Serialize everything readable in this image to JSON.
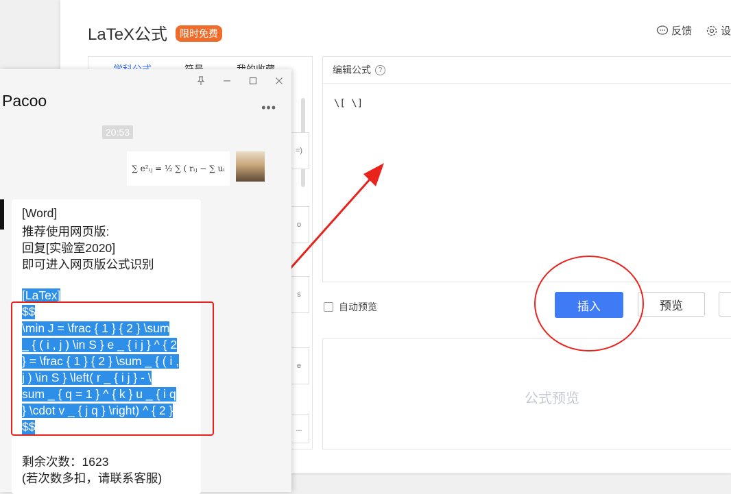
{
  "latex_dialog": {
    "title": "LaTeX公式",
    "badge": "限时免费",
    "feedback_label": "反馈",
    "settings_label": "设",
    "tabs": [
      "学科公式",
      "符号",
      "我的收藏"
    ],
    "thumb_labels": [
      "=)",
      "o",
      "s",
      "e",
      "..."
    ],
    "editor_label": "编辑公式",
    "editor_content": "\\[ \\]",
    "auto_preview_label": "自动预览",
    "insert_label": "插入",
    "preview_label": "预览",
    "preview_placeholder": "公式预览",
    "colors": {
      "primary": "#3e7bf4",
      "badge": "#f06c2b",
      "annotation": "#e8231c"
    }
  },
  "chat": {
    "title": "Pacoo",
    "time": "20:53",
    "sent_image_formula": "∑ e²ᵢⱼ = ½ ∑ ( rᵢⱼ − ∑ uᵢ",
    "message_lines": [
      "[Word]",
      "推荐使用网页版:",
      "回复[实验室2020]",
      "即可进入网页版公式识别",
      "[LaTex]",
      "$$",
      "\\min J = \\frac { 1 } { 2 } \\sum",
      " _ { ( i , j ) \\in S } e _ { i j } ^ { 2",
      " } = \\frac { 1 } { 2 } \\sum _ { ( i ,",
      " j ) \\in S } \\left( r _ { i j } - \\",
      "sum _ { q = 1 } ^ { k } u _ { i q",
      " } \\cdot v _ { j q } \\right) ^ { 2 }",
      "$$",
      "剩余次数：1623",
      "(若次数多扣，请联系客服)"
    ]
  }
}
